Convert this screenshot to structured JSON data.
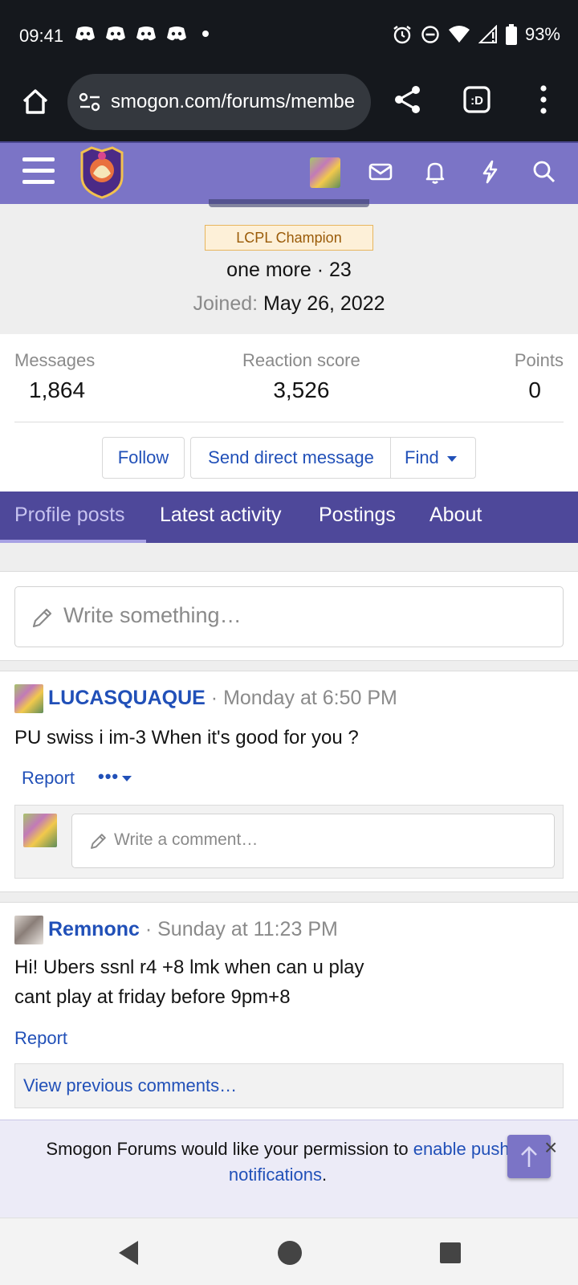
{
  "status_bar": {
    "time": "09:41",
    "battery": "93%",
    "icons": [
      "discord-icon",
      "discord-icon",
      "discord-icon",
      "discord-icon",
      "alarm-icon",
      "dnd-icon",
      "wifi-icon",
      "signal-icon",
      "battery-icon"
    ]
  },
  "browser": {
    "url": "smogon.com/forums/membe",
    "icons": [
      "home-icon",
      "site-settings-icon",
      "share-icon",
      "tab-switcher-icon",
      "overflow-menu-icon"
    ]
  },
  "site_header": {
    "icons": [
      "menu-icon",
      "site-logo",
      "avatar",
      "mail-icon",
      "bell-icon",
      "bolt-icon",
      "search-icon"
    ]
  },
  "profile": {
    "banner": "LCPL Champion",
    "title_line": "one more · 23",
    "joined_label": "Joined:",
    "joined_date": "May 26, 2022"
  },
  "stats": {
    "messages_label": "Messages",
    "messages_value": "1,864",
    "reaction_label": "Reaction score",
    "reaction_value": "3,526",
    "points_label": "Points",
    "points_value": "0"
  },
  "actions": {
    "follow": "Follow",
    "send_dm": "Send direct message",
    "find": "Find"
  },
  "tabs": [
    "Profile posts",
    "Latest activity",
    "Postings",
    "About"
  ],
  "write_placeholder": "Write something…",
  "posts": [
    {
      "user": "LUCASQUAQUE",
      "time": "· Monday at 6:50 PM",
      "body_lines": [
        "PU swiss i im-3 When it's good for you ?"
      ],
      "report": "Report",
      "more": "•••",
      "comment_placeholder": "Write a comment…"
    },
    {
      "user": "Remnonc",
      "time": "· Sunday at 11:23 PM",
      "body_lines": [
        "Hi! Ubers ssnl r4 +8 lmk when can u play",
        "cant play at friday before 9pm+8"
      ],
      "report": "Report",
      "view_previous": "View previous comments…"
    }
  ],
  "push_banner": {
    "text": "Smogon Forums would like your permission to",
    "link": "enable push notifications",
    "end": ".",
    "close": "×"
  },
  "colors": {
    "header": "#7b74c6",
    "tabs": "#4e489a",
    "link": "#2150b8"
  }
}
